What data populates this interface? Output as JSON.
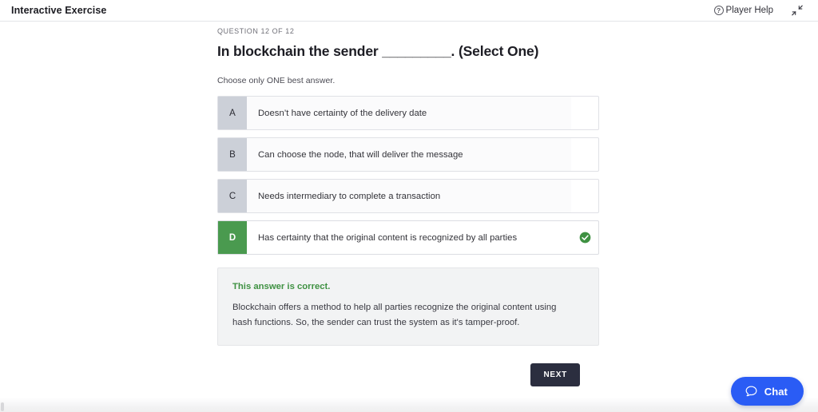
{
  "topbar": {
    "app_title": "Interactive Exercise",
    "help_label": "Player Help",
    "help_icon": "question-circle-icon",
    "collapse_icon": "collapse-arrows-icon"
  },
  "question": {
    "counter": "QUESTION 12 OF 12",
    "title": "In blockchain the sender _________. (Select One)",
    "instruction": "Choose only ONE best answer.",
    "options": [
      {
        "letter": "A",
        "text": "Doesn’t have certainty of the delivery date",
        "selected": false,
        "marked_correct": false
      },
      {
        "letter": "B",
        "text": "Can choose the node, that will deliver the message",
        "selected": false,
        "marked_correct": false
      },
      {
        "letter": "C",
        "text": "Needs intermediary to complete a transaction",
        "selected": false,
        "marked_correct": false
      },
      {
        "letter": "D",
        "text": "Has certainty that the original content is recognized by all parties",
        "selected": true,
        "marked_correct": true
      }
    ]
  },
  "feedback": {
    "title": "This answer is correct.",
    "body": "Blockchain offers a method to help all parties recognize the original content using hash functions. So, the sender can trust the system as it's tamper-proof."
  },
  "actions": {
    "next_label": "NEXT"
  },
  "chat": {
    "label": "Chat",
    "icon": "chat-bubble-icon"
  },
  "colors": {
    "correct_green": "#4a9a4f",
    "feedback_green": "#3f9142",
    "letter_gray": "#ccd0d8",
    "next_dark": "#2b2e3f",
    "chat_blue": "#2a5cf5"
  }
}
